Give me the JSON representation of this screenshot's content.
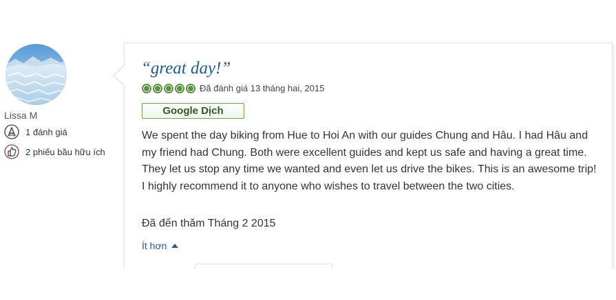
{
  "reviewer": {
    "name": "Lissa M",
    "avatar_icon": "glacier-photo-avatar",
    "reviews_count": "1 đánh giá",
    "helpful_votes": "2 phiếu bầu hữu ích",
    "reviews_icon": "reviewer-badge-icon",
    "helpful_icon": "thumbs-up-badge-icon"
  },
  "review": {
    "title": "“great day!”",
    "rating": 5,
    "rating_max": 5,
    "rating_date": "Đã đánh giá 13 tháng hai, 2015",
    "translate_label": "Google Dịch",
    "body": "We spent the day biking from Hue to Hoi An with our guides Chung and Hâu. I had Hâu and my friend had Chung. Both were excellent guides and kept us safe and having a great time. They let us stop any time we wanted and even let us drive the bikes. This is an awesome trip! I highly recommend it to anyone who wishes to travel between the two cities.",
    "visit_date": "Đã đến thăm Tháng 2 2015",
    "less_label": "Ít hơn"
  },
  "colors": {
    "title_blue": "#1f5b8c",
    "bubble_green": "#589442",
    "body_text": "#333333"
  }
}
